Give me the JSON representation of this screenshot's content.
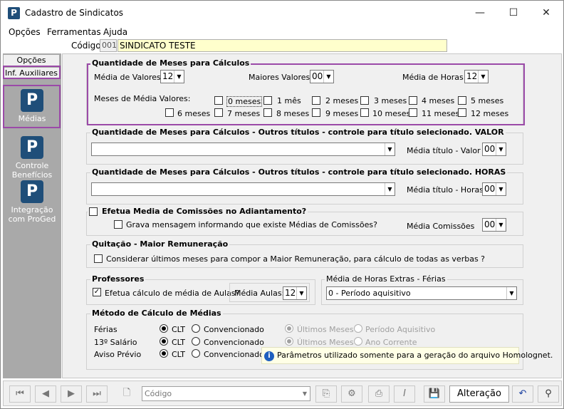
{
  "window": {
    "title": "Cadastro de Sindicatos",
    "minimize": "—",
    "maximize": "☐",
    "close": "✕"
  },
  "menu": {
    "items": [
      "Opções",
      "Ferramentas",
      "Ajuda"
    ]
  },
  "codigo": {
    "label": "Código:",
    "number": "001",
    "name": "SINDICATO TESTE"
  },
  "sidebar": {
    "tabs": [
      "Opções",
      "Inf. Auxiliares"
    ],
    "items": [
      {
        "label": "Médias",
        "icon": "p-logo-icon"
      },
      {
        "label_line1": "Controle",
        "label_line2": "Benefícios",
        "icon": "p-logo-icon"
      },
      {
        "label_line1": "Integração",
        "label_line2": "com ProGed",
        "icon": "p-logo-icon"
      }
    ]
  },
  "qmc": {
    "title": "Quantidade de Meses para Cálculos",
    "media_valores_label": "Média de Valores:",
    "media_valores": "12",
    "maiores_valores_label": "Maiores Valores:",
    "maiores_valores": "00",
    "media_horas_label": "Média de Horas:",
    "media_horas": "12",
    "meses_label": "Meses de Média Valores:",
    "meses_opts": [
      "0 meses",
      "1 mês",
      "2 meses",
      "3 meses",
      "4 meses",
      "5 meses",
      "6 meses",
      "7 meses",
      "8 meses",
      "9 meses",
      "10 meses",
      "11 meses",
      "12 meses"
    ]
  },
  "outros_valor": {
    "title": "Quantidade de Meses para Cálculos - Outros títulos - controle para título selecionado. VALOR",
    "media_label": "Média título - Valor",
    "media_value": "00",
    "select_value": ""
  },
  "outros_horas": {
    "title": "Quantidade de Meses para Cálculos - Outros títulos - controle para título selecionado. HORAS",
    "media_label": "Média título - Horas",
    "media_value": "00",
    "select_value": ""
  },
  "comissoes": {
    "title": "Efetua Media de Comissões no Adiantamento?",
    "grava_label": "Grava mensagem informando que existe Médias de Comissões?",
    "media_label": "Média Comissões",
    "media_value": "00"
  },
  "quitacao": {
    "title": "Quitação - Maior Remuneração",
    "considerar_label": "Considerar últimos meses para compor a Maior Remuneração, para cálculo de todas as verbas ?"
  },
  "professores": {
    "title": "Professores",
    "efetua_label": "Efetua cálculo de média de Aulas?",
    "check": "✓",
    "media_label": "Média Aulas:",
    "media_value": "12"
  },
  "horas_extras": {
    "title": "Média de Horas Extras - Férias",
    "value": "0 - Período aquisitivo"
  },
  "metodo": {
    "title": "Método de Cálculo de Médias",
    "rows": [
      {
        "label": "Férias",
        "a": "CLT",
        "b": "Convencionado",
        "c": "Últimos Meses",
        "d": "Período Aquisitivo"
      },
      {
        "label": "13º Salário",
        "a": "CLT",
        "b": "Convencionado",
        "c": "Últimos Meses",
        "d": "Ano Corrente"
      },
      {
        "label": "Aviso Prévio",
        "a": "CLT",
        "b": "Convencionado"
      }
    ],
    "info": "Parâmetros utilizado somente para a geração do arquivo Homolognet.",
    "info_icon": "i"
  },
  "toolbar": {
    "search_placeholder": "Código",
    "status": "Alteração"
  }
}
